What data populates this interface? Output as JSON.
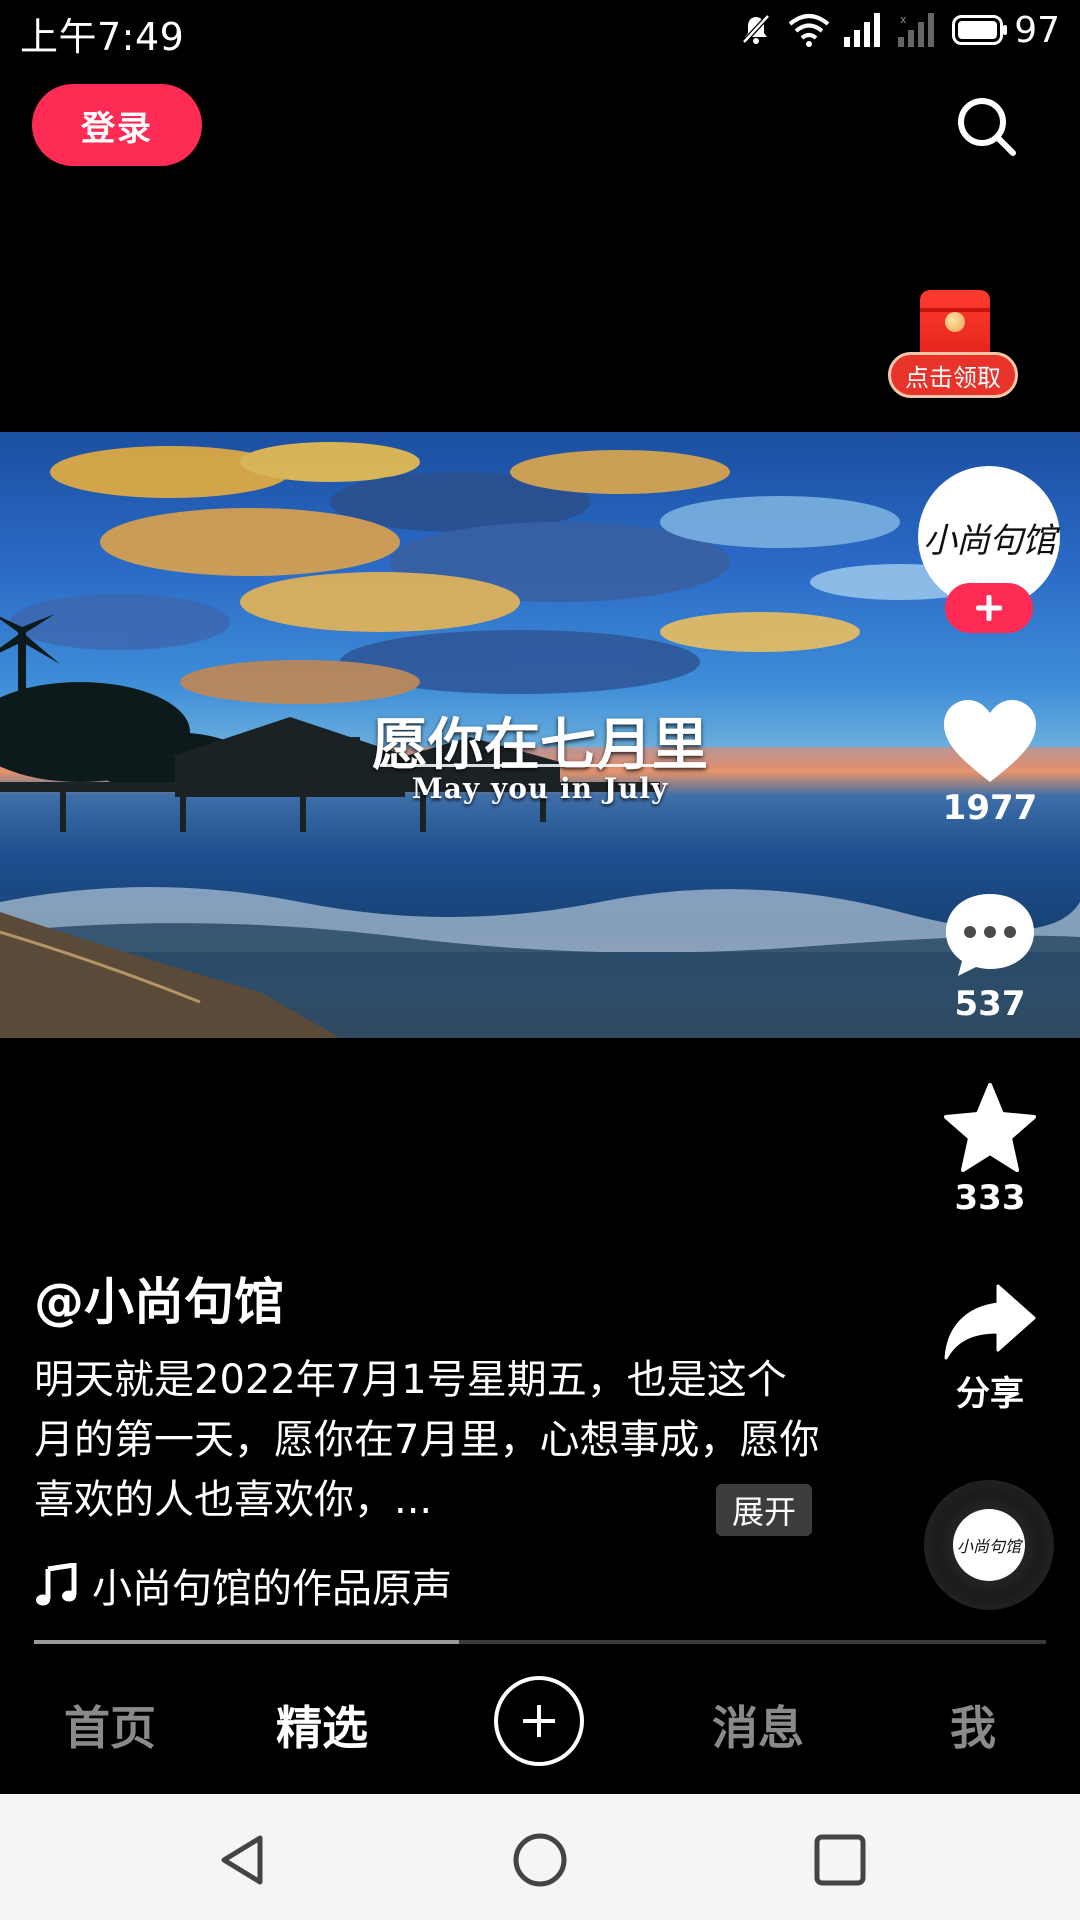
{
  "status_bar": {
    "time": "上午7:49",
    "battery": "97"
  },
  "top": {
    "login_label": "登录",
    "red_packet_label": "点击领取"
  },
  "video": {
    "title": "愿你在七月里",
    "subtitle": "May you in July",
    "progress_fraction": 0.42
  },
  "author": {
    "avatar_text": "小尚句馆",
    "handle": "@小尚句馆"
  },
  "actions": {
    "like_count": "1977",
    "comment_count": "537",
    "favorite_count": "333",
    "share_label": "分享"
  },
  "caption": {
    "text": "明天就是2022年7月1号星期五，也是这个月的第一天，愿你在7月里，心想事成，愿你喜欢的人也喜欢你，...",
    "expand_label": "展开"
  },
  "music": {
    "title": "小尚句馆的作品原声"
  },
  "tabs": {
    "home": "首页",
    "featured": "精选",
    "messages": "消息",
    "me": "我"
  },
  "colors": {
    "brand": "#fe2c55",
    "background": "#000000",
    "inactive_tab": "#8a8a8a"
  }
}
